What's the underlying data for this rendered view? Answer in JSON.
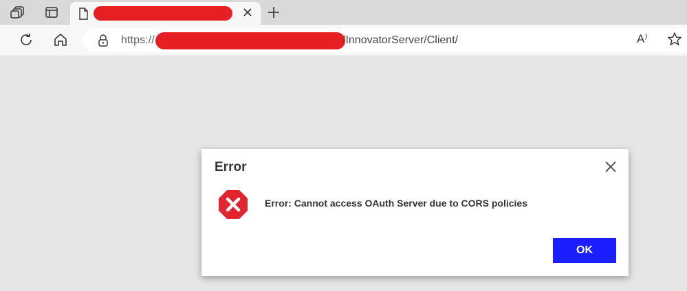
{
  "browser": {
    "tab": {
      "title": "",
      "icon": "file-icon"
    },
    "toolbar": {
      "url_scheme": "https://",
      "url_path": "/InnovatorServer/Client/",
      "read_aloud_glyph": "A⁾"
    },
    "icons": [
      "workspaces-icon",
      "tab-actions-icon",
      "file-icon",
      "close-icon",
      "new-tab-icon",
      "refresh-icon",
      "home-icon",
      "lock-icon",
      "read-aloud-icon",
      "favorite-star-icon"
    ]
  },
  "dialog": {
    "title": "Error",
    "message": "Error: Cannot access OAuth Server due to CORS policies",
    "ok_label": "OK",
    "colors": {
      "error_icon": "#e1252f",
      "ok_button": "#1b1fff"
    }
  },
  "colors": {
    "redaction": "#e62022",
    "page_background": "#e6e6e6"
  }
}
